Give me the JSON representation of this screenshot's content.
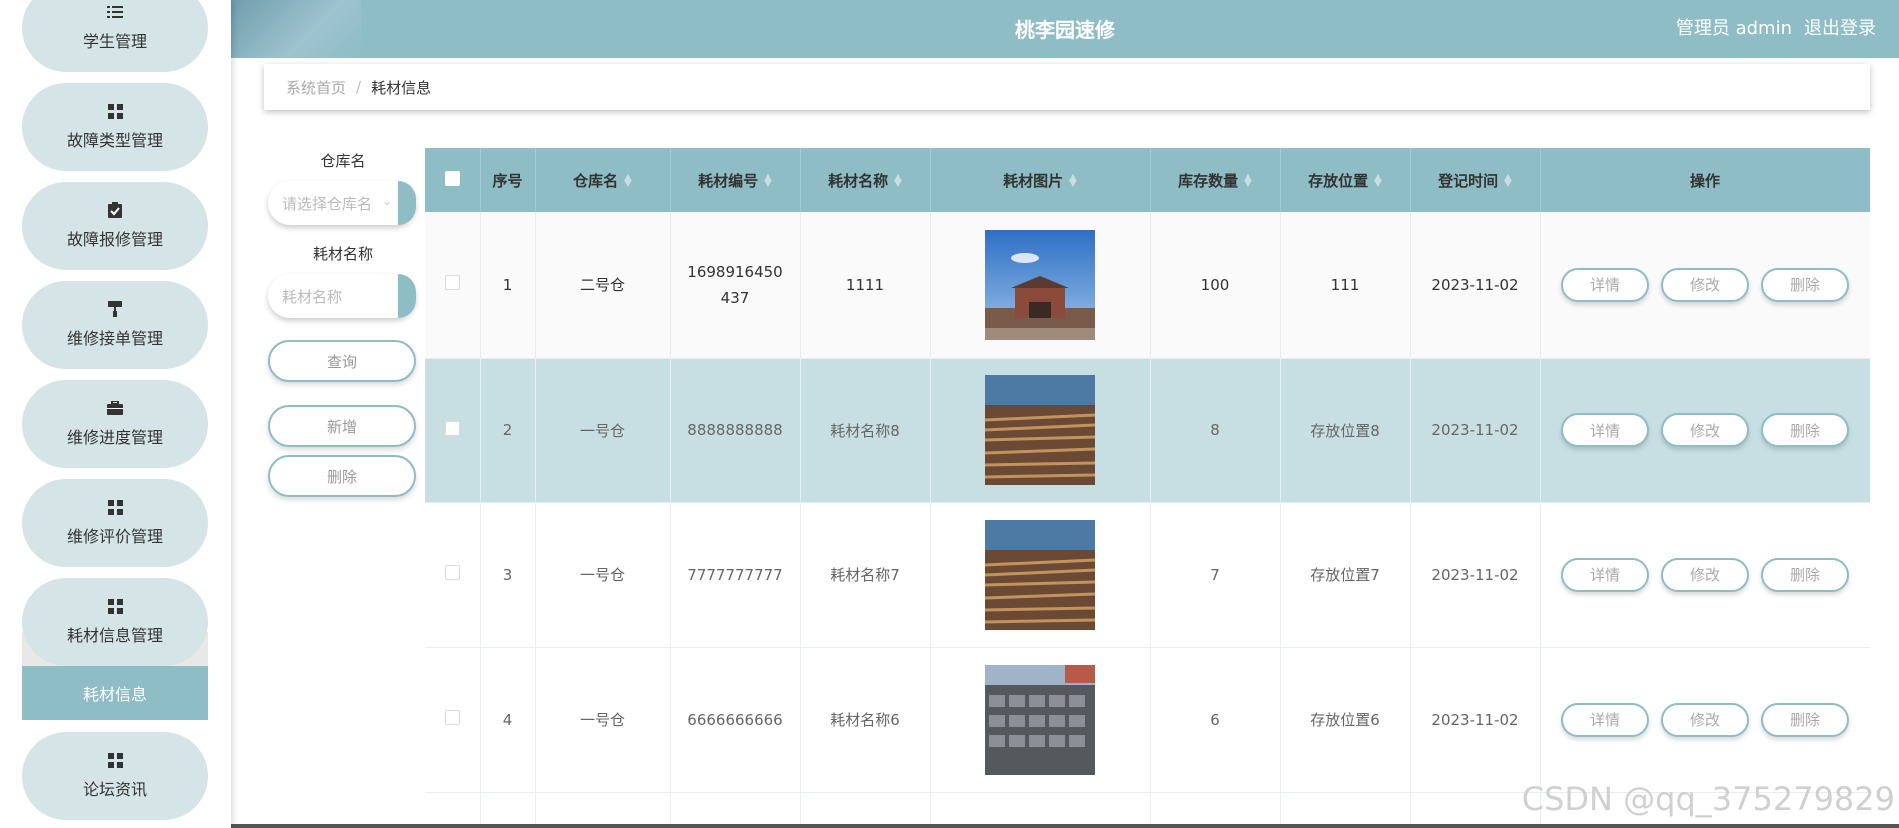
{
  "sidebar": {
    "items": [
      {
        "label": "学生管理",
        "icon": "list-icon"
      },
      {
        "label": "故障类型管理",
        "icon": "grid-icon"
      },
      {
        "label": "故障报修管理",
        "icon": "clipboard-check-icon"
      },
      {
        "label": "维修接单管理",
        "icon": "paint-roller-icon"
      },
      {
        "label": "维修进度管理",
        "icon": "briefcase-icon"
      },
      {
        "label": "维修评价管理",
        "icon": "grid-icon"
      },
      {
        "label": "耗材信息管理",
        "icon": "grid-icon"
      },
      {
        "label": "论坛资讯",
        "icon": "grid-icon"
      }
    ],
    "active_sub": "耗材信息"
  },
  "header": {
    "title": "桃李园速修",
    "user": "管理员 admin",
    "logout": "退出登录"
  },
  "breadcrumb": {
    "home": "系统首页",
    "sep": "/",
    "current": "耗材信息"
  },
  "search": {
    "warehouse_label": "仓库名",
    "warehouse_placeholder": "请选择仓库名",
    "name_label": "耗材名称",
    "name_placeholder": "耗材名称",
    "query": "查询",
    "add": "新增",
    "delete": "删除"
  },
  "table": {
    "headers": [
      "序号",
      "仓库名",
      "耗材编号",
      "耗材名称",
      "耗材图片",
      "库存数量",
      "存放位置",
      "登记时间",
      "操作"
    ],
    "rows": [
      {
        "no": "1",
        "warehouse": "二号仓",
        "code": "1698916450437",
        "name": "1111",
        "qty": "100",
        "location": "111",
        "date": "2023-11-02"
      },
      {
        "no": "2",
        "warehouse": "一号仓",
        "code": "8888888888",
        "name": "耗材名称8",
        "qty": "8",
        "location": "存放位置8",
        "date": "2023-11-02"
      },
      {
        "no": "3",
        "warehouse": "一号仓",
        "code": "7777777777",
        "name": "耗材名称7",
        "qty": "7",
        "location": "存放位置7",
        "date": "2023-11-02"
      },
      {
        "no": "4",
        "warehouse": "一号仓",
        "code": "6666666666",
        "name": "耗材名称6",
        "qty": "6",
        "location": "存放位置6",
        "date": "2023-11-02"
      }
    ],
    "ops": {
      "detail": "详情",
      "edit": "修改",
      "delete": "删除"
    }
  },
  "watermark": "CSDN @qq_375279829",
  "colors": {
    "accent": "#8ebdc6",
    "menu_bg": "#d5e4e7",
    "row_highlight": "#c7dfe3"
  }
}
